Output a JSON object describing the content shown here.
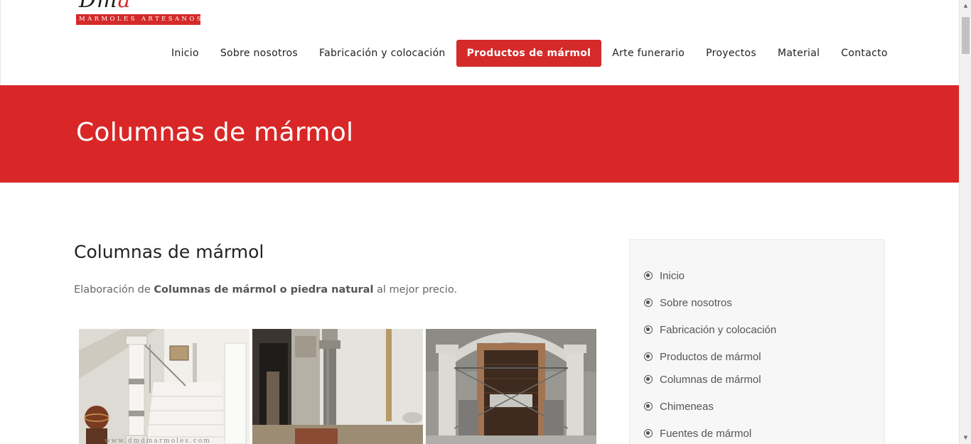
{
  "header": {
    "logo_script": "Dma",
    "logo_tagline": "MÁRMOLES ARTESANOS",
    "nav": [
      {
        "label": "Inicio",
        "active": false
      },
      {
        "label": "Sobre nosotros",
        "active": false
      },
      {
        "label": "Fabricación y colocación",
        "active": false
      },
      {
        "label": "Productos de mármol",
        "active": true
      },
      {
        "label": "Arte funerario",
        "active": false
      },
      {
        "label": "Proyectos",
        "active": false
      },
      {
        "label": "Material",
        "active": false
      },
      {
        "label": "Contacto",
        "active": false
      }
    ]
  },
  "banner": {
    "title": "Columnas de mármol"
  },
  "content": {
    "title": "Columnas de mármol",
    "intro_before": "Elaboración de ",
    "intro_bold": "Columnas de mármol o piedra natural",
    "intro_after": " al mejor precio.",
    "photos": [
      {
        "name": "staircase-marble-column-photo",
        "watermark": "www.dmdmarmoles.com"
      },
      {
        "name": "courtyard-stone-column-photo"
      },
      {
        "name": "facade-marble-columns-photo"
      }
    ]
  },
  "sidebar": {
    "items": [
      {
        "label": "Inicio"
      },
      {
        "label": "Sobre nosotros"
      },
      {
        "label": "Fabricación y colocación"
      },
      {
        "label": "Productos de mármol"
      },
      {
        "label": "Columnas de mármol"
      },
      {
        "label": "Chimeneas"
      },
      {
        "label": "Fuentes de mármol"
      }
    ]
  },
  "colors": {
    "brand_red": "#d92727",
    "nav_active": "#d42a2a",
    "sidebar_bg": "#f7f7f7",
    "text_dark": "#222222",
    "text_muted": "#666666"
  },
  "icons": {
    "sidebar_bullet": "radio-circle-icon",
    "scroll_up": "arrow-up-icon",
    "scroll_down": "arrow-down-icon"
  }
}
